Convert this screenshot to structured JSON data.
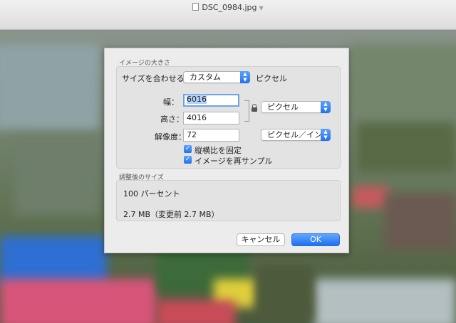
{
  "window": {
    "title": "DSC_0984.jpg"
  },
  "dialog": {
    "image_size_section_title": "イメージの大きさ",
    "fit_label": "サイズを合わせる：",
    "fit_value": "カスタム",
    "fit_unit": "ピクセル",
    "width_label": "幅：",
    "width_value": "6016",
    "height_label": "高さ：",
    "height_value": "4016",
    "dimension_unit": "ピクセル",
    "resolution_label": "解像度：",
    "resolution_value": "72",
    "resolution_unit": "ピクセル／インチ",
    "keep_ratio_label": "縦横比を固定",
    "keep_ratio_checked": true,
    "resample_label": "イメージを再サンプル",
    "resample_checked": true,
    "result_section_title": "調整後のサイズ",
    "result_percent": "100 パーセント",
    "result_filesize": "2.7 MB（変更前 2.7 MB）",
    "cancel_label": "キャンセル",
    "ok_label": "OK"
  },
  "colors": {
    "accent": "#1f72f0",
    "sheet_bg": "#ececec"
  }
}
